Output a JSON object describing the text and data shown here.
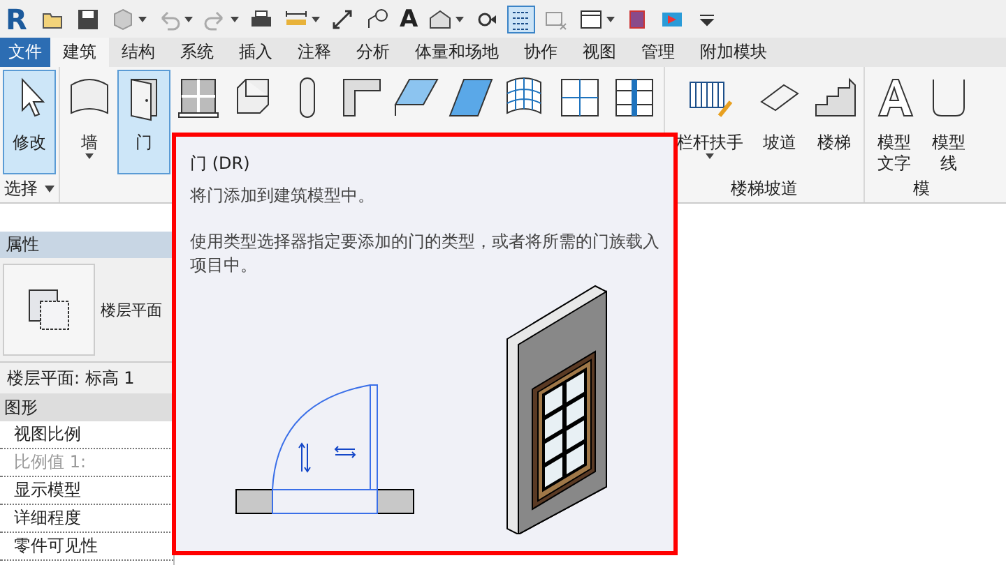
{
  "quick_access": {
    "logo": "R",
    "items": [
      {
        "kind": "open",
        "selected": false
      },
      {
        "kind": "save",
        "selected": false
      },
      {
        "kind": "sync",
        "caret": true,
        "selected": false
      },
      {
        "kind": "undo",
        "caret": true,
        "selected": false
      },
      {
        "kind": "redo",
        "caret": true,
        "selected": false
      },
      {
        "kind": "print",
        "selected": false
      },
      {
        "kind": "measure",
        "caret": true,
        "selected": false
      },
      {
        "kind": "dimension",
        "selected": false
      },
      {
        "kind": "tag",
        "selected": false
      },
      {
        "kind": "text",
        "selected": false,
        "glyph": "A"
      },
      {
        "kind": "house",
        "caret": true,
        "selected": false
      },
      {
        "kind": "section",
        "selected": false
      },
      {
        "kind": "thinlines",
        "selected": true
      },
      {
        "kind": "closewin",
        "selected": false
      },
      {
        "kind": "switchwin",
        "caret": true,
        "selected": false
      },
      {
        "kind": "plugin",
        "selected": false
      },
      {
        "kind": "plugin2",
        "selected": false
      },
      {
        "kind": "menu",
        "selected": false
      }
    ]
  },
  "tabs": [
    {
      "label": "文件",
      "kind": "application",
      "selected": false
    },
    {
      "label": "建筑",
      "kind": "tab",
      "selected": true
    },
    {
      "label": "结构",
      "kind": "tab",
      "selected": false
    },
    {
      "label": "系统",
      "kind": "tab",
      "selected": false
    },
    {
      "label": "插入",
      "kind": "tab",
      "selected": false
    },
    {
      "label": "注释",
      "kind": "tab",
      "selected": false
    },
    {
      "label": "分析",
      "kind": "tab",
      "selected": false
    },
    {
      "label": "体量和场地",
      "kind": "tab",
      "selected": false
    },
    {
      "label": "协作",
      "kind": "tab",
      "selected": false
    },
    {
      "label": "视图",
      "kind": "tab",
      "selected": false
    },
    {
      "label": "管理",
      "kind": "tab",
      "selected": false
    },
    {
      "label": "附加模块",
      "kind": "tab",
      "selected": false
    }
  ],
  "ribbon": [
    {
      "label": "选择",
      "dropdown": true,
      "tools": [
        {
          "kind": "cursor",
          "label": [
            "修改"
          ],
          "selected": true
        }
      ]
    },
    {
      "tools": [
        {
          "kind": "wall",
          "label": [
            "墙"
          ],
          "selected": false,
          "caret": true
        },
        {
          "kind": "door",
          "label": [
            "门"
          ],
          "selected": true
        },
        {
          "kind": "window",
          "selected": false
        },
        {
          "kind": "component",
          "selected": false
        },
        {
          "kind": "column",
          "selected": false
        },
        {
          "kind": "roof",
          "selected": false
        },
        {
          "kind": "ceiling",
          "selected": false
        },
        {
          "kind": "floor",
          "selected": false
        },
        {
          "kind": "curtainsystem",
          "selected": false
        },
        {
          "kind": "curtaingrid",
          "selected": false
        },
        {
          "kind": "mullion",
          "selected": false
        }
      ]
    },
    {
      "label": "楼梯坡道",
      "tools": [
        {
          "kind": "railing",
          "label": [
            "栏杆扶手"
          ],
          "selected": false,
          "caret": true
        },
        {
          "kind": "ramp",
          "label": [
            "坡道"
          ],
          "selected": false
        },
        {
          "kind": "stair",
          "label": [
            "楼梯"
          ],
          "selected": false
        }
      ]
    },
    {
      "label": "模",
      "tools": [
        {
          "kind": "modeltext",
          "label": [
            "模型",
            "文字"
          ],
          "selected": false
        },
        {
          "kind": "modelline",
          "label": [
            "模型",
            "线"
          ],
          "selected": false
        }
      ]
    }
  ],
  "properties": {
    "title": "属性",
    "type_name": "楼层平面",
    "instance": "楼层平面: 标高 1",
    "group": "图形",
    "rows": [
      {
        "label": "视图比例",
        "disabled": false
      },
      {
        "label": "比例值 1:",
        "disabled": true
      },
      {
        "label": "显示模型",
        "disabled": false
      },
      {
        "label": "详细程度",
        "disabled": false
      },
      {
        "label": "零件可见性",
        "disabled": false
      }
    ]
  },
  "tooltip": {
    "title": "门 (DR)",
    "summary": "将门添加到建筑模型中。",
    "description": "使用类型选择器指定要添加的门的类型，或者将所需的门族载入项目中。"
  }
}
